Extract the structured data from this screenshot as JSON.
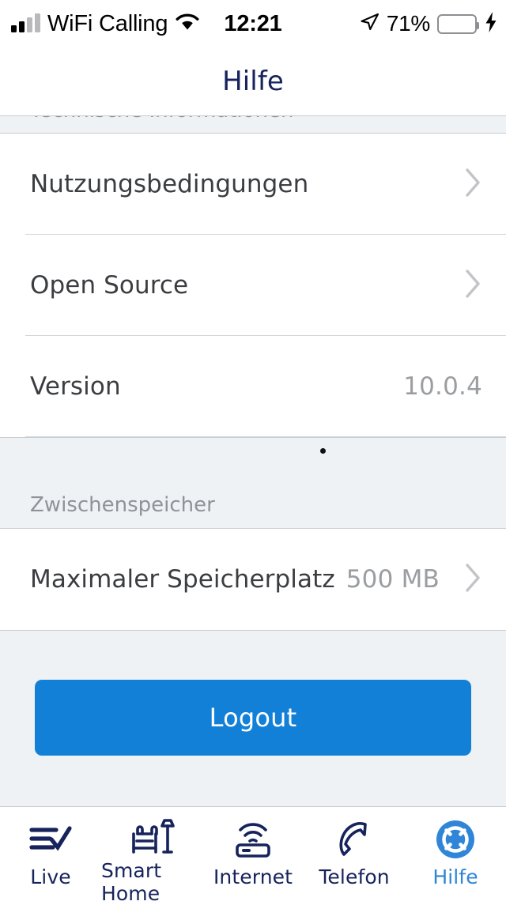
{
  "status_bar": {
    "carrier": "WiFi Calling",
    "time": "12:21",
    "battery_percent": "71%",
    "battery_level": 71,
    "icons": [
      "signal-bars-icon",
      "wifi-icon",
      "location-arrow-icon",
      "battery-icon",
      "charging-bolt-icon"
    ],
    "colors": {
      "battery_fill": "#4cd964",
      "text": "#000000"
    }
  },
  "nav": {
    "title": "Hilfe"
  },
  "sections": [
    {
      "header": "Technische Informationen",
      "clipped": true,
      "rows": [
        {
          "label": "Nutzungsbedingungen",
          "value": "",
          "chevron": true
        },
        {
          "label": "Open Source",
          "value": "",
          "chevron": true
        },
        {
          "label": "Version",
          "value": "10.0.4",
          "chevron": false
        }
      ]
    },
    {
      "header": "Zwischenspeicher",
      "clipped": false,
      "rows": [
        {
          "label": "Maximaler Speicherplatz",
          "value": "500 MB",
          "chevron": true
        }
      ]
    }
  ],
  "logout": {
    "label": "Logout",
    "color": "#1380d8"
  },
  "tab_bar": {
    "active_color": "#2f86d8",
    "inactive_color": "#16235c",
    "tabs": [
      {
        "label": "Live",
        "icon": "list-check-icon",
        "active": false
      },
      {
        "label": "Smart Home",
        "icon": "armchair-lamp-icon",
        "active": false
      },
      {
        "label": "Internet",
        "icon": "router-wifi-icon",
        "active": false
      },
      {
        "label": "Telefon",
        "icon": "phone-handset-icon",
        "active": false
      },
      {
        "label": "Hilfe",
        "icon": "lifebuoy-icon",
        "active": true
      }
    ]
  }
}
